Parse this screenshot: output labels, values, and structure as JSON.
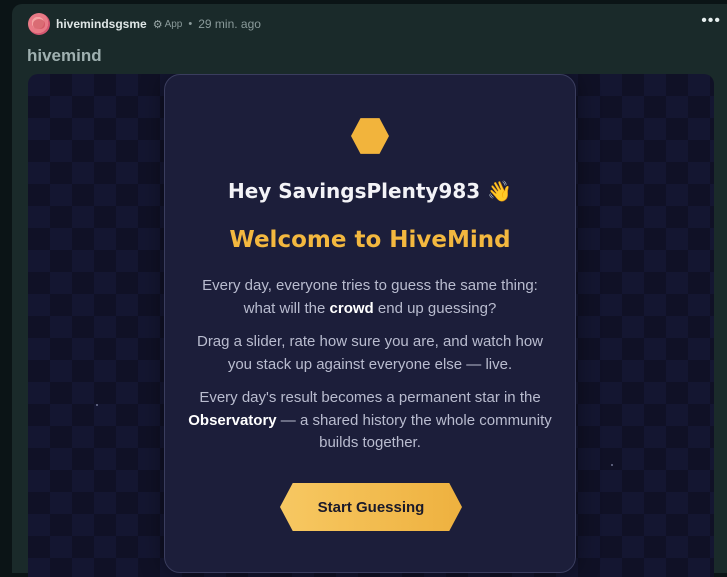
{
  "post": {
    "username": "hivemindsgsme",
    "app_badge": "App",
    "separator": "•",
    "time": "29 min. ago",
    "more": "•••",
    "title": "hivemind"
  },
  "card": {
    "greeting": "Hey SavingsPlenty983 👋",
    "welcome": "Welcome to HiveMind",
    "p1_a": "Every day, everyone tries to guess the same thing: what will the ",
    "p1_bold": "crowd",
    "p1_b": " end up guessing?",
    "p2": "Drag a slider, rate how sure you are, and watch how you stack up against everyone else — live.",
    "p3_a": "Every day's result becomes a permanent star in the ",
    "p3_bold": "Observatory",
    "p3_b": " — a shared history the whole community builds together.",
    "button": "Start Guessing"
  },
  "icons": {
    "avatar": "avatar-icon",
    "gear": "gear-icon",
    "more": "more-options-icon",
    "hexagon": "hexagon-logo-icon"
  },
  "colors": {
    "accent": "#f3b83f",
    "card_bg": "#1c1e3a",
    "post_bg": "#1a2a2a"
  }
}
